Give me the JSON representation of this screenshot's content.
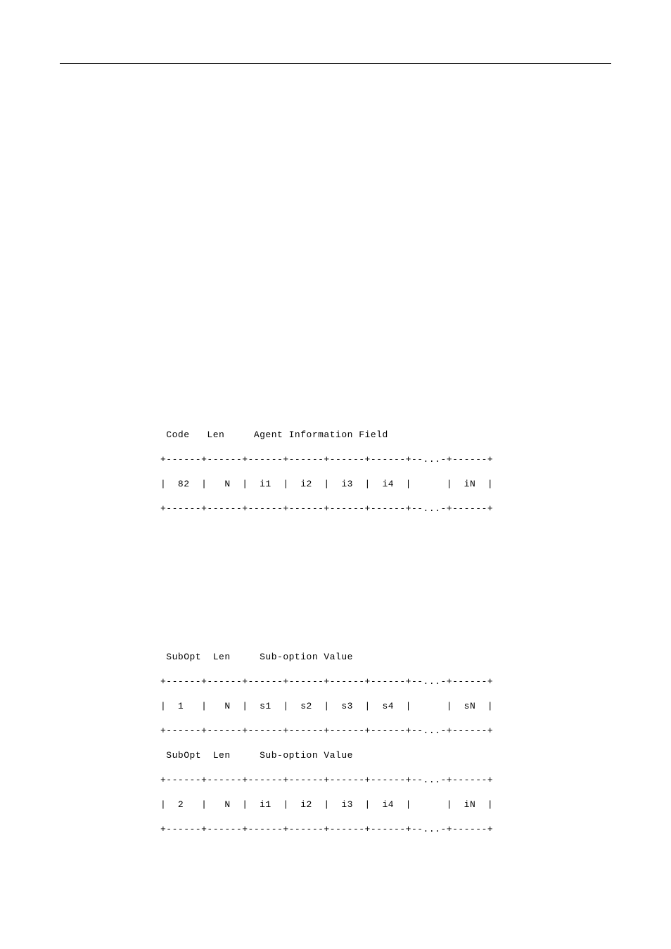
{
  "diagram1": {
    "header": " Code   Len     Agent Information Field",
    "border": "+------+------+------+------+------+------+--...-+------+",
    "row": "|  82  |   N  |  i1  |  i2  |  i3  |  i4  |      |  iN  |",
    "border2": "+------+------+------+------+------+------+--...-+------+"
  },
  "diagram2": {
    "sub1_header": " SubOpt  Len     Sub-option Value",
    "sub1_border": "+------+------+------+------+------+------+--...-+------+",
    "sub1_row": "|  1   |   N  |  s1  |  s2  |  s3  |  s4  |      |  sN  |",
    "sub1_border2": "+------+------+------+------+------+------+--...-+------+",
    "sub2_header": " SubOpt  Len     Sub-option Value",
    "sub2_border": "+------+------+------+------+------+------+--...-+------+",
    "sub2_row": "|  2   |   N  |  i1  |  i2  |  i3  |  i4  |      |  iN  |",
    "sub2_border2": "+------+------+------+------+------+------+--...-+------+"
  }
}
